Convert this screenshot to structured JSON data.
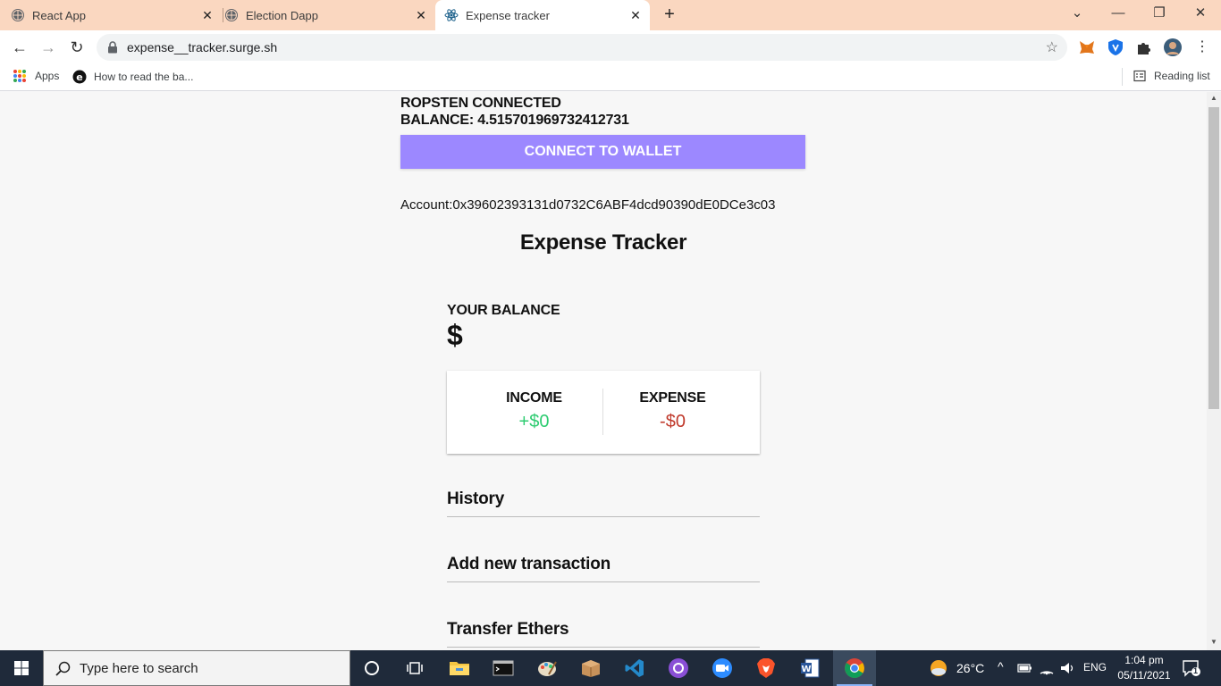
{
  "browser": {
    "tabs": [
      {
        "label": "React App",
        "favicon": "globe-icon",
        "active": false
      },
      {
        "label": "Election Dapp",
        "favicon": "globe-icon",
        "active": false
      },
      {
        "label": "Expense tracker",
        "favicon": "react-icon",
        "active": true
      }
    ],
    "new_tab_label": "+",
    "url": "expense__tracker.surge.sh",
    "bookmarks": [
      {
        "label": "Apps",
        "icon": "apps-grid-icon"
      },
      {
        "label": "How to read the ba...",
        "icon": "site-e-icon"
      }
    ],
    "reading_list_label": "Reading list"
  },
  "page": {
    "network_status": "ROPSTEN CONNECTED",
    "eth_balance_line": "BALANCE: 4.515701969732412731",
    "connect_button_label": "CONNECT TO WALLET",
    "account_line": "Account:0x39602393131d0732C6ABF4dcd90390dE0DCe3c03",
    "app_title": "Expense Tracker",
    "balance_label": "YOUR BALANCE",
    "balance_amount": "$",
    "income_label": "INCOME",
    "income_amount": "+$0",
    "expense_label": "EXPENSE",
    "expense_amount": "-$0",
    "history_heading": "History",
    "add_transaction_heading": "Add new transaction",
    "transfer_heading": "Transfer Ethers",
    "colors": {
      "accent": "#9c88ff",
      "income": "#2ecc71",
      "expense": "#c0392b"
    }
  },
  "taskbar": {
    "search_placeholder": "Type here to search",
    "apps": [
      "cortana-icon",
      "task-view-icon",
      "file-explorer-icon",
      "terminal-icon",
      "paint-icon",
      "package-icon",
      "vscode-icon",
      "github-desktop-icon",
      "zoom-icon",
      "brave-icon",
      "word-icon",
      "chrome-icon"
    ],
    "weather": "26°C",
    "language": "ENG",
    "time": "1:04 pm",
    "date": "05/11/2021",
    "notification_count": "1"
  }
}
